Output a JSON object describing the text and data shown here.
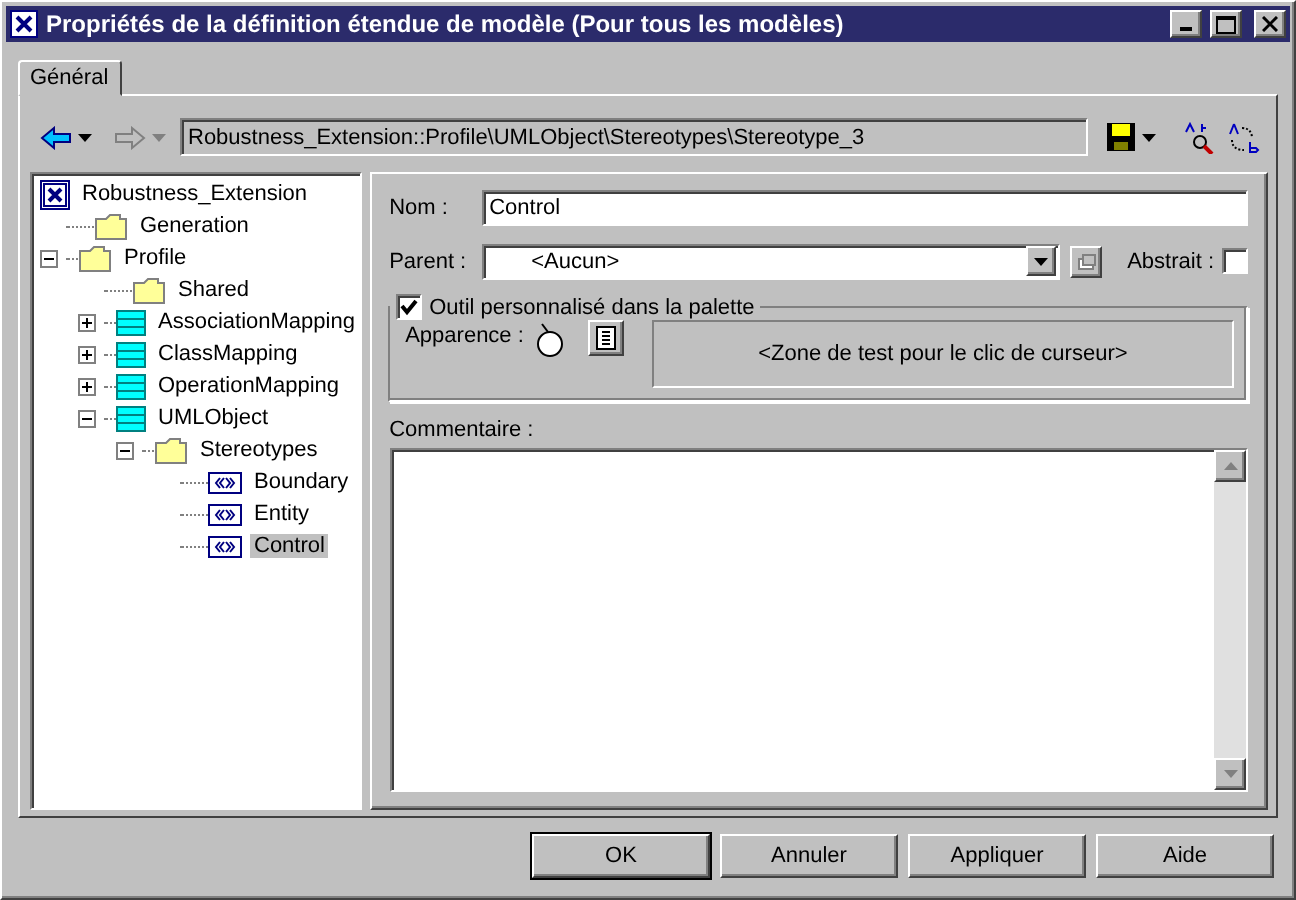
{
  "window": {
    "title": "Propriétés de la définition étendue de modèle (Pour tous les modèles)"
  },
  "tabs": [
    {
      "label": "Général",
      "selected": true
    }
  ],
  "toolbar": {
    "path": "Robustness_Extension::Profile\\UMLObject\\Stereotypes\\Stereotype_3"
  },
  "tree": [
    {
      "label": "Robustness_Extension",
      "kind": "model",
      "selected": false,
      "children": [
        {
          "label": "Generation",
          "kind": "folder",
          "selected": false
        },
        {
          "label": "Profile",
          "kind": "folder",
          "expanded": true,
          "selected": false,
          "children": [
            {
              "label": "Shared",
              "kind": "folder",
              "selected": false
            },
            {
              "label": "AssociationMapping",
              "kind": "metaclass",
              "expanded": false,
              "selected": false
            },
            {
              "label": "ClassMapping",
              "kind": "metaclass",
              "expanded": false,
              "selected": false
            },
            {
              "label": "OperationMapping",
              "kind": "metaclass",
              "expanded": false,
              "selected": false
            },
            {
              "label": "UMLObject",
              "kind": "metaclass",
              "expanded": true,
              "selected": false,
              "children": [
                {
                  "label": "Stereotypes",
                  "kind": "folder",
                  "expanded": true,
                  "selected": false,
                  "children": [
                    {
                      "label": "Boundary",
                      "kind": "stereotype",
                      "selected": false
                    },
                    {
                      "label": "Entity",
                      "kind": "stereotype",
                      "selected": false
                    },
                    {
                      "label": "Control",
                      "kind": "stereotype",
                      "selected": true
                    }
                  ]
                }
              ]
            }
          ]
        }
      ]
    }
  ],
  "form": {
    "name": {
      "label": "Nom :",
      "value": "Control"
    },
    "parent": {
      "label": "Parent :",
      "value": "<Aucun>"
    },
    "abstract": {
      "label": "Abstrait :",
      "checked": false
    },
    "custom_tool": {
      "label": "Outil personnalisé dans la palette",
      "checked": true
    },
    "appearance": {
      "label": "Apparence :"
    },
    "test_zone": "<Zone de test pour le clic de curseur>",
    "comment": {
      "label": "Commentaire :"
    }
  },
  "buttons": [
    {
      "label": "OK",
      "default": true
    },
    {
      "label": "Annuler",
      "default": false
    },
    {
      "label": "Appliquer",
      "default": false
    },
    {
      "label": "Aide",
      "default": false
    }
  ]
}
